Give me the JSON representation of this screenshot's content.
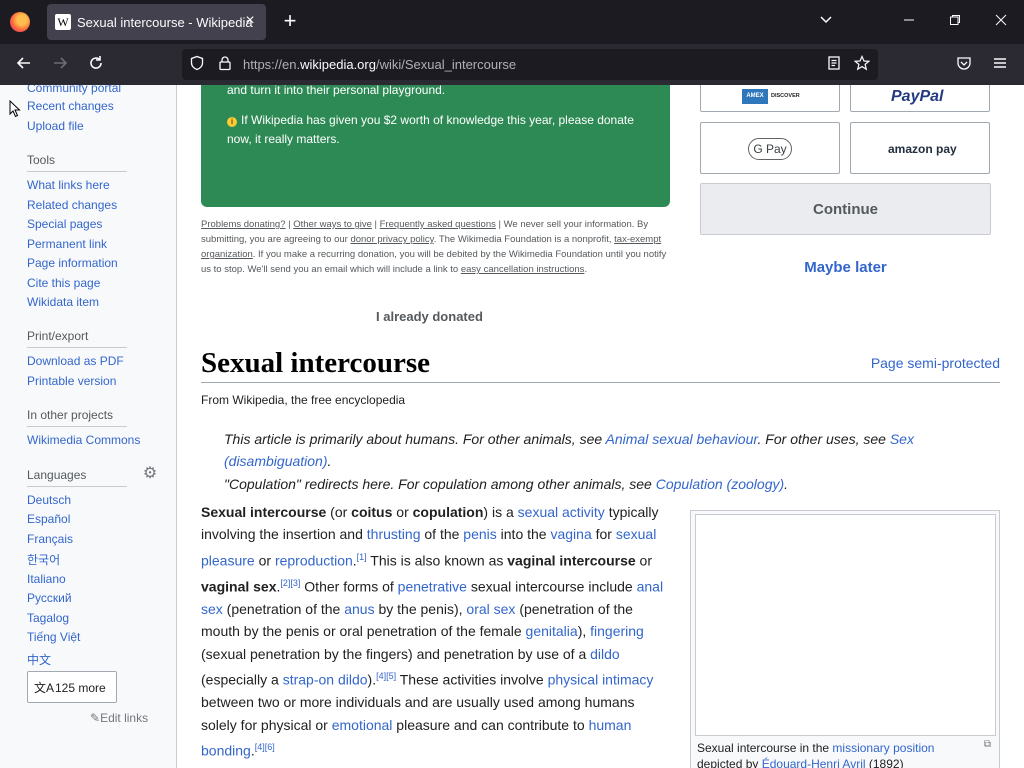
{
  "browser": {
    "tab_title": "Sexual intercourse - Wikipedia",
    "favicon_letter": "W",
    "url_prefix": "https://en.",
    "url_domain": "wikipedia.org",
    "url_path": "/wiki/Sexual_intercourse"
  },
  "sidebar": {
    "top_links": [
      "Community portal",
      "Recent changes",
      "Upload file"
    ],
    "tools_heading": "Tools",
    "tools": [
      "What links here",
      "Related changes",
      "Special pages",
      "Permanent link",
      "Page information",
      "Cite this page",
      "Wikidata item"
    ],
    "print_heading": "Print/export",
    "print": [
      "Download as PDF",
      "Printable version"
    ],
    "projects_heading": "In other projects",
    "projects": [
      "Wikimedia Commons"
    ],
    "languages_heading": "Languages",
    "languages": [
      "Deutsch",
      "Español",
      "Français",
      "한국어",
      "Italiano",
      "Русский",
      "Tagalog",
      "Tiếng Việt",
      "中文"
    ],
    "more_label": "125 more",
    "edit_links": "Edit links"
  },
  "donation": {
    "line1": "and turn it into their personal playground.",
    "line2": "If Wikipedia has given you $2 worth of knowledge this year, please donate",
    "line3": "now, it really matters.",
    "fine_print": {
      "problems": "Problems donating?",
      "other_ways": "Other ways to give",
      "faq": "Frequently asked questions",
      "t1": " | We never sell your information. By submitting, you are agreeing to our ",
      "privacy": "donor privacy policy",
      "t2": ". The Wikimedia Foundation is a nonprofit, ",
      "tax": "tax-exempt organization",
      "t3": ". If you make a recurring donation, you will be debited by the Wikimedia Foundation until you notify us to stop. We'll send you an email which will include a link to ",
      "cancel": "easy cancellation instructions",
      "t4": "."
    },
    "already_donated": "I already donated",
    "pay_amex": "AMEX",
    "pay_discover": "DISCOVER",
    "pay_paypal": "PayPal",
    "pay_gpay": "G Pay",
    "pay_amazon": "amazon pay",
    "continue_label": "Continue",
    "maybe_later": "Maybe later"
  },
  "article": {
    "title": "Sexual intercourse",
    "protection": "Page semi-protected",
    "from": "From Wikipedia, the free encyclopedia",
    "hat1_a": "This article is primarily about humans. For other animals, see ",
    "hat1_link1": "Animal sexual behaviour",
    "hat1_b": ". For other uses, see ",
    "hat1_link2": "Sex (disambiguation)",
    "hat1_c": ".",
    "hat2_a": "\"Copulation\" redirects here. For copulation among other animals, see ",
    "hat2_link": "Copulation (zoology)",
    "hat2_b": "."
  },
  "infobox": {
    "caption_a": "Sexual intercourse in the ",
    "caption_link": "missionary position",
    "caption_b": "depicted by ",
    "caption_link2": "Édouard-Henri Avril",
    "caption_c": " (1892)"
  },
  "colors": {
    "link": "#3366cc",
    "banner": "#2d8a55",
    "chrome_dark": "#1c1b22",
    "chrome_nav": "#2b2a33"
  }
}
